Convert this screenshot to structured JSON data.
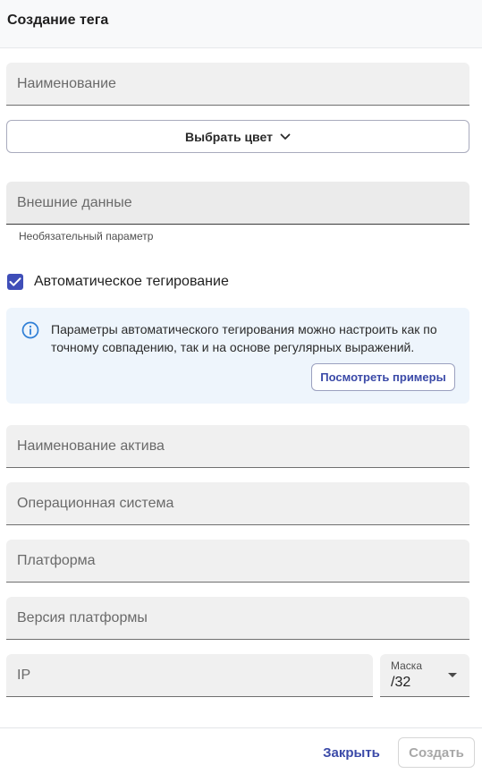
{
  "header": {
    "title": "Создание тега"
  },
  "form": {
    "name_placeholder": "Наименование",
    "color_button_label": "Выбрать цвет",
    "external_data_placeholder": "Внешние данные",
    "external_data_hint": "Необязательный параметр",
    "auto_tagging": {
      "label": "Автоматическое тегирование",
      "checked": true
    },
    "info": {
      "text": "Параметры автоматического тегирования можно настроить как по точному совпадению, так и на основе регулярных выражений.",
      "examples_button": "Посмотреть примеры"
    },
    "asset_name_placeholder": "Наименование актива",
    "os_placeholder": "Операционная система",
    "platform_placeholder": "Платформа",
    "platform_version_placeholder": "Версия платформы",
    "ip_placeholder": "IP",
    "mask": {
      "label": "Маска",
      "value": "/32"
    }
  },
  "footer": {
    "close_label": "Закрыть",
    "create_label": "Создать"
  },
  "colors": {
    "accent": "#3f4eb8",
    "info_bg": "#eef5fc",
    "info_icon": "#2f7fd6"
  }
}
